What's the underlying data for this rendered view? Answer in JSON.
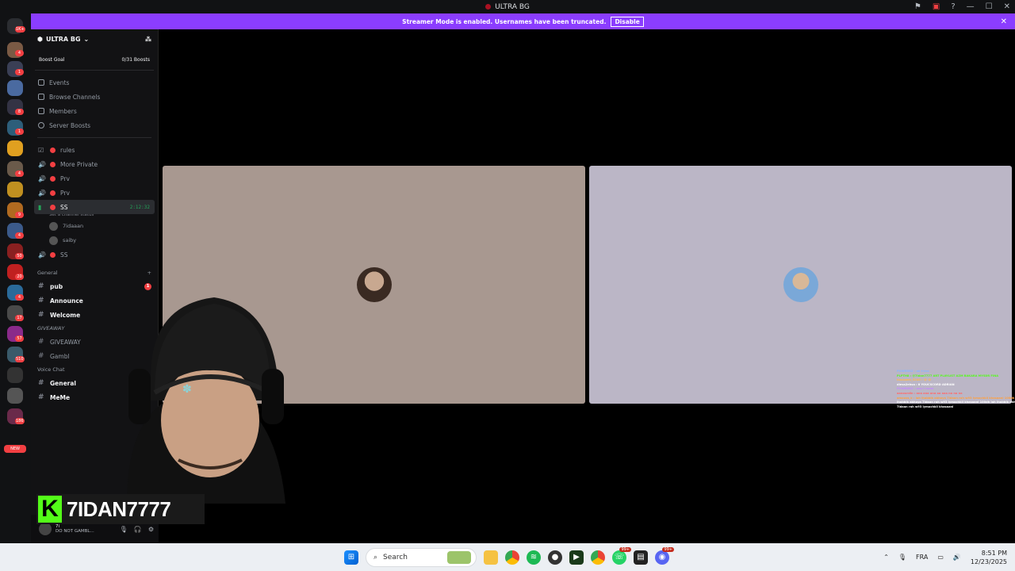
{
  "window": {
    "title": "ULTRA BG"
  },
  "banner": {
    "text": "Streamer Mode is enabled. Usernames have been truncated.",
    "button": "Disable"
  },
  "rail": {
    "badges": [
      "1K+",
      "4",
      "1",
      "8",
      "1",
      "4",
      "9",
      "4",
      "50",
      "20",
      "4",
      "17",
      "57",
      "510",
      "186",
      "NEW"
    ]
  },
  "server": {
    "name": "ULTRA BG",
    "boost_goal_label": "Boost Goal",
    "boost_goal_value": "0/31 Boosts",
    "nav": [
      "Events",
      "Browse Channels",
      "Members",
      "Server Boosts"
    ],
    "channels_top": [
      {
        "name": "rules"
      },
      {
        "name": "More Private"
      },
      {
        "name": "Prv"
      },
      {
        "name": "Prv"
      }
    ],
    "active_channel": {
      "name": "SS",
      "timer": "2:12:32",
      "status": "Set a channel status"
    },
    "voice_users": [
      "7idaaan",
      "saiby"
    ],
    "channel_after": {
      "name": "SS"
    },
    "category_general": "General",
    "general_channels": [
      {
        "name": "pub",
        "unread": "1"
      },
      {
        "name": "Announce"
      },
      {
        "name": "Welcome"
      }
    ],
    "category_giveaway": "GIVEAWAY",
    "giveaway_channels": [
      {
        "name": "GIVEAWAY"
      },
      {
        "name": "Gambl"
      }
    ],
    "category_voice": "Voice Chat",
    "voice_channels": [
      {
        "name": "General"
      },
      {
        "name": "MeMe"
      }
    ]
  },
  "user_panel": {
    "name": "7i",
    "status": "DO NOT GAMBL..."
  },
  "overlay": {
    "k": "K",
    "streamer": "7IDAN7777"
  },
  "chat": [
    "POWRRRZ : ok t'eva",
    "PLPTH8 : @7idan7777 ART PLAYLIST AZM BAKARA MYSDR FINA",
    "houssem_5240 : 😂 😂",
    "diesa2ehsa : 8 YOUCSCORD ADRIAN",
    "POWRRRZ : ana f room",
    "aanourdin : ana ana ana aa aaa na na na",
    "amouss_k : lah lhabbik akhoya 7idaan rah w93 lymochkil khasaani 100dh",
    "lhabbik akhoya 7idaan rah w93 lymochkil khasaani 100dh lah lhabbik akhoya",
    "7idaan rah w93 lymochkil khasaani"
  ],
  "taskbar": {
    "search_placeholder": "Search",
    "lang": "FRA",
    "time": "8:51 PM",
    "date": "12/23/2025",
    "whatsapp_badge": "99+",
    "discord_badge": "99+"
  },
  "colors": {
    "banner": "#8b3dff",
    "kick_green": "#53fc18",
    "tile_left": "#a89890",
    "tile_right": "#bbb6c6"
  }
}
